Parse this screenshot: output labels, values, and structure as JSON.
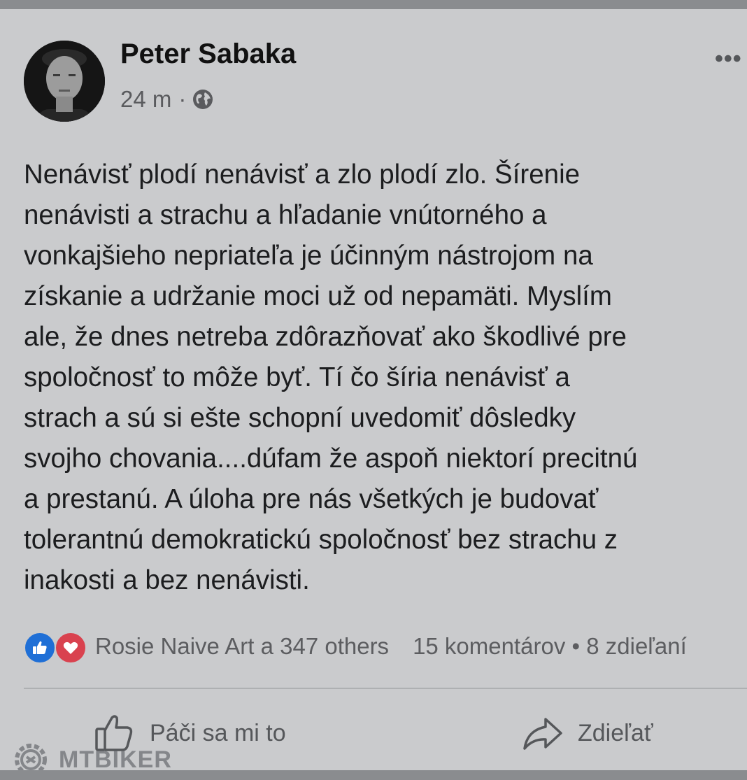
{
  "post": {
    "author": "Peter Sabaka",
    "time": "24 m",
    "separator": "·",
    "privacy_icon": "globe-icon",
    "more_label": "•••",
    "text_lines": [
      "Nenávisť plodí nenávisť a zlo plodí zlo. Šírenie",
      "nenávisti a strachu a hľadanie vnútorného a",
      "vonkajšieho nepriateľa je účinným nástrojom na",
      "získanie a udržanie moci už od nepamäti. Myslím",
      "ale, že dnes netreba zdôrazňovať ako škodlivé pre",
      "spoločnosť to môže byť. Tí čo šíria nenávisť a",
      "strach a sú si ešte schopní uvedomiť dôsledky",
      "svojho chovania....dúfam že aspoň niektorí precitnú",
      "a prestanú. A úloha pre nás všetkých je budovať",
      "tolerantnú demokratickú spoločnosť bez strachu z",
      "inakosti a bez nenávisti."
    ]
  },
  "reactions": {
    "icons": [
      "like-icon",
      "love-icon"
    ],
    "reactors": "Rosie Naive Art a 347 others",
    "counts": "15 komentárov • 8 zdieľaní"
  },
  "actions": {
    "like_label": "Páči sa mi to",
    "share_label": "Zdieľať"
  },
  "watermark": {
    "text": "MTBIKER"
  },
  "colors": {
    "card_bg": "#cacbcd",
    "like_blue": "#1f6fd6",
    "love_red": "#d9424f"
  }
}
